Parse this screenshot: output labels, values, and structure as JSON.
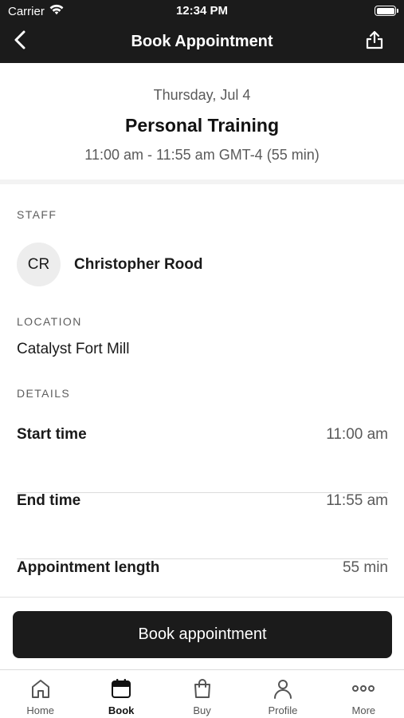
{
  "status_bar": {
    "carrier": "Carrier",
    "time": "12:34 PM"
  },
  "nav": {
    "title": "Book Appointment",
    "back_icon": "chevron-left-icon",
    "share_icon": "share-icon"
  },
  "summary": {
    "date": "Thursday, Jul 4",
    "service": "Personal Training",
    "time_range": "11:00 am - 11:55 am GMT-4 (55 min)"
  },
  "staff": {
    "section_label": "STAFF",
    "initials": "CR",
    "name": "Christopher Rood"
  },
  "location": {
    "section_label": "LOCATION",
    "name": "Catalyst Fort Mill"
  },
  "details": {
    "section_label": "DETAILS",
    "rows": [
      {
        "label": "Start time",
        "value": "11:00 am"
      },
      {
        "label": "End time",
        "value": "11:55 am"
      },
      {
        "label": "Appointment length",
        "value": "55 min"
      }
    ]
  },
  "actions": {
    "book_label": "Book appointment"
  },
  "tabbar": {
    "active": "Book",
    "tabs": [
      {
        "label": "Home",
        "icon": "home-icon"
      },
      {
        "label": "Book",
        "icon": "calendar-icon"
      },
      {
        "label": "Buy",
        "icon": "shopping-bag-icon"
      },
      {
        "label": "Profile",
        "icon": "person-icon"
      },
      {
        "label": "More",
        "icon": "more-dots-icon"
      }
    ]
  },
  "colors": {
    "header_bg": "#1b1b1b",
    "button_bg": "#1b1b1b",
    "muted_text": "#5a5a5a",
    "avatar_bg": "#ededed"
  }
}
